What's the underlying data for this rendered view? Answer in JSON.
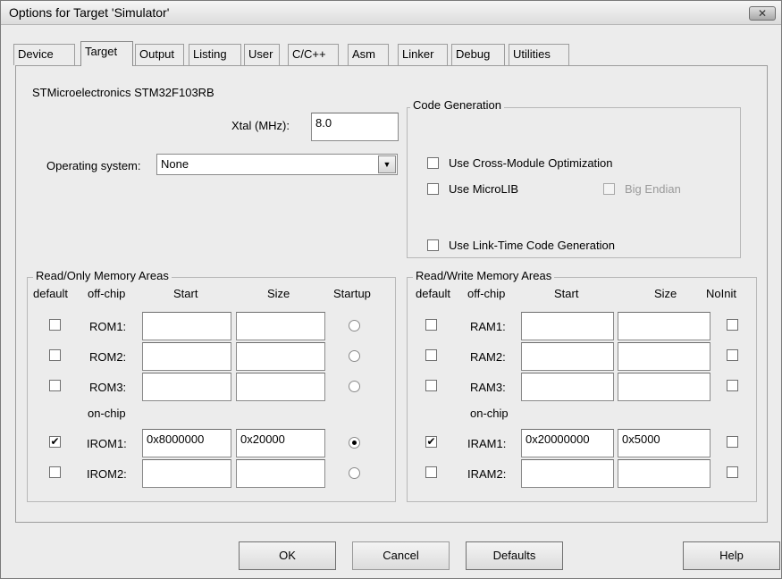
{
  "window": {
    "title": "Options for Target 'Simulator'",
    "close_glyph": "✕"
  },
  "tabs": [
    "Device",
    "Target",
    "Output",
    "Listing",
    "User",
    "C/C++",
    "Asm",
    "Linker",
    "Debug",
    "Utilities"
  ],
  "active_tab": "Target",
  "device_name": "STMicroelectronics STM32F103RB",
  "xtal": {
    "label": "Xtal (MHz):",
    "value": "8.0"
  },
  "os": {
    "label": "Operating system:",
    "value": "None"
  },
  "code_generation": {
    "title": "Code Generation",
    "cross_module": {
      "label": "Use Cross-Module Optimization",
      "checked": false
    },
    "microlib": {
      "label": "Use MicroLIB",
      "checked": false
    },
    "big_endian": {
      "label": "Big Endian",
      "checked": false,
      "enabled": false
    },
    "link_time": {
      "label": "Use Link-Time Code Generation",
      "checked": false
    }
  },
  "rom": {
    "title": "Read/Only Memory Areas",
    "headers": {
      "default": "default",
      "offchip": "off-chip",
      "start": "Start",
      "size": "Size",
      "last": "Startup"
    },
    "onchip_label": "on-chip",
    "rows": [
      {
        "name": "ROM1:",
        "default": false,
        "start": "",
        "size": "",
        "startup": false
      },
      {
        "name": "ROM2:",
        "default": false,
        "start": "",
        "size": "",
        "startup": false
      },
      {
        "name": "ROM3:",
        "default": false,
        "start": "",
        "size": "",
        "startup": false
      },
      {
        "name": "IROM1:",
        "default": true,
        "start": "0x8000000",
        "size": "0x20000",
        "startup": true
      },
      {
        "name": "IROM2:",
        "default": false,
        "start": "",
        "size": "",
        "startup": false
      }
    ]
  },
  "ram": {
    "title": "Read/Write Memory Areas",
    "headers": {
      "default": "default",
      "offchip": "off-chip",
      "start": "Start",
      "size": "Size",
      "last": "NoInit"
    },
    "onchip_label": "on-chip",
    "rows": [
      {
        "name": "RAM1:",
        "default": false,
        "start": "",
        "size": "",
        "noinit": false
      },
      {
        "name": "RAM2:",
        "default": false,
        "start": "",
        "size": "",
        "noinit": false
      },
      {
        "name": "RAM3:",
        "default": false,
        "start": "",
        "size": "",
        "noinit": false
      },
      {
        "name": "IRAM1:",
        "default": true,
        "start": "0x20000000",
        "size": "0x5000",
        "noinit": false
      },
      {
        "name": "IRAM2:",
        "default": false,
        "start": "",
        "size": "",
        "noinit": false
      }
    ]
  },
  "buttons": {
    "ok": "OK",
    "cancel": "Cancel",
    "defaults": "Defaults",
    "help": "Help"
  },
  "icons": {
    "check": "✔",
    "dropdown": "▼"
  }
}
